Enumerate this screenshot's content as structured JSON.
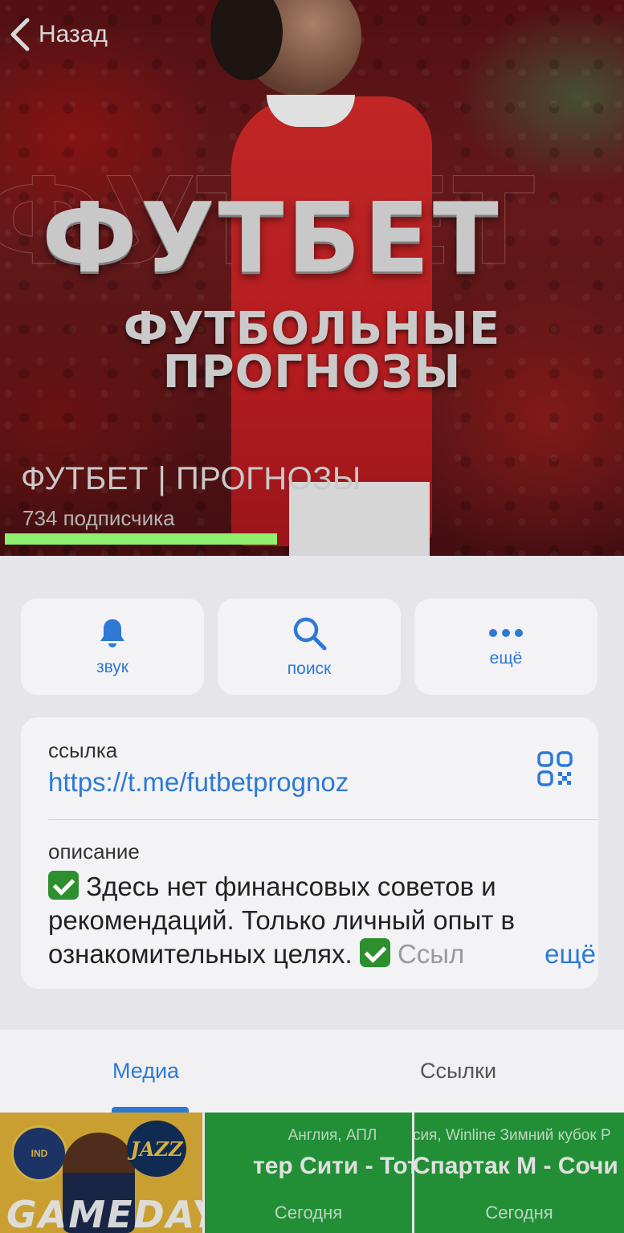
{
  "nav": {
    "back_label": "Назад"
  },
  "channel": {
    "banner_title": "ФУТБЕТ",
    "banner_subtitle_line1": "ФУТБОЛЬНЫЕ",
    "banner_subtitle_line2": "ПРОГНОЗЫ",
    "name": "ФУТБЕТ | ПРОГНОЗЫ",
    "subscribers": "734 подписчика",
    "underline_color": "#8ff070"
  },
  "actions": [
    {
      "label": "звук",
      "icon": "bell-icon"
    },
    {
      "label": "поиск",
      "icon": "search-icon"
    },
    {
      "label": "ещё",
      "icon": "more-dots-icon"
    }
  ],
  "info": {
    "link_caption": "ссылка",
    "link_url": "https://t.me/futbetprognoz",
    "qr_icon": "qr-code-icon",
    "description_caption": "описание",
    "description_part1": "Здесь нет финансовых советов и рекомендаций. Только личный опыт в ознакомительных целях.",
    "description_part2": "Ссыл",
    "more_label": "ещё"
  },
  "tabs": [
    {
      "label": "Медиа",
      "active": true
    },
    {
      "label": "Ссылки",
      "active": false
    }
  ],
  "media": [
    {
      "kind": "image",
      "label_text": "GAMEDAY",
      "badge": "JAZZ"
    },
    {
      "league": "Англия, АПЛ",
      "match": "тер Сити - Тоттен",
      "when": "Сегодня"
    },
    {
      "league": "сия, Winline Зимний кубок Р",
      "match": "Спартак М - Сочи",
      "when": "Сегодня"
    }
  ],
  "colors": {
    "accent": "#2e79d5",
    "tile_green": "#27a33e",
    "background": "#e5e5ea"
  }
}
